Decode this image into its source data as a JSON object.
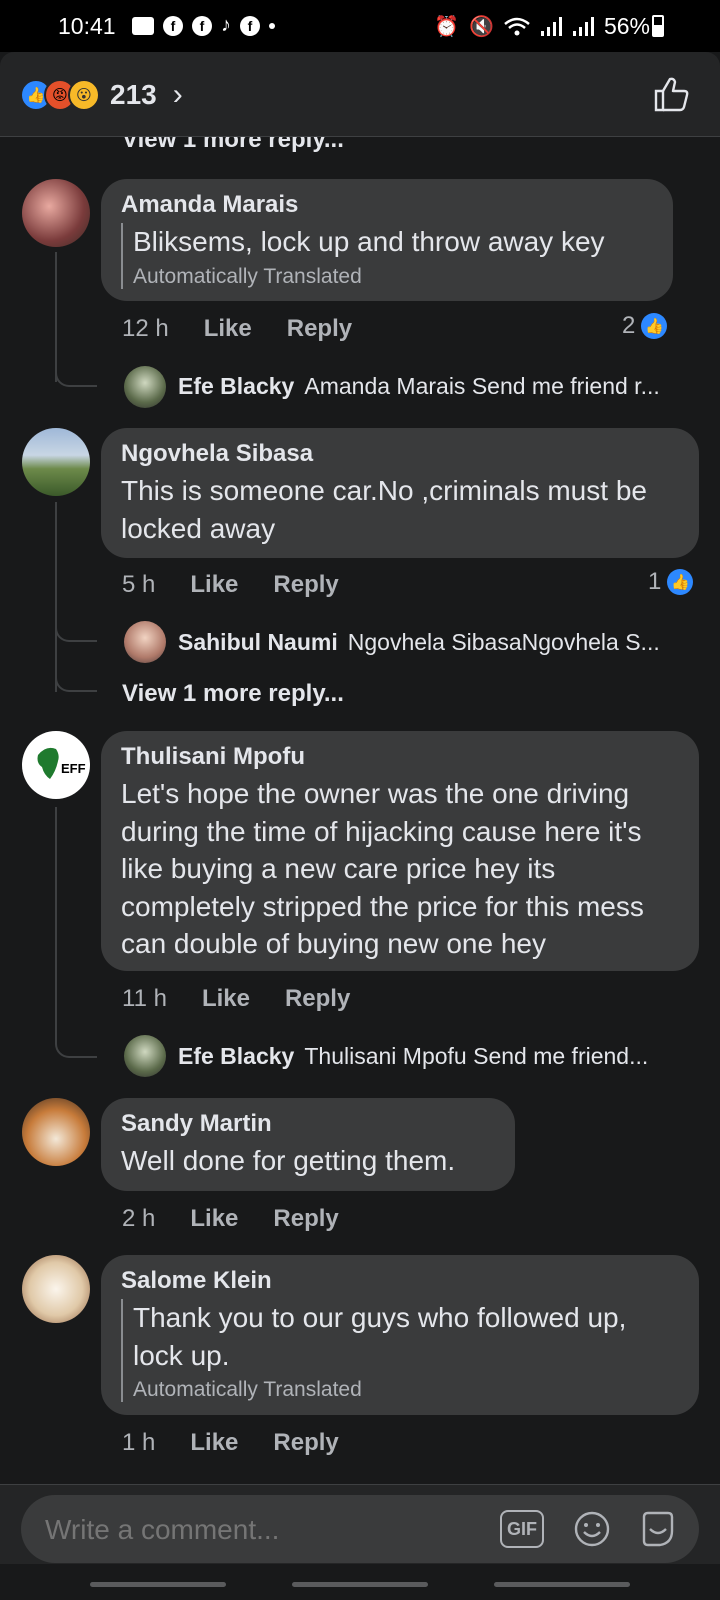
{
  "status_bar": {
    "time": "10:41",
    "battery": "56%"
  },
  "header": {
    "reaction_count": "213",
    "chevron": "›"
  },
  "thread": {
    "top_view_more": "View 1 more reply...",
    "comments": [
      {
        "author": "Amanda Marais",
        "text": "Bliksems, lock up and throw away key",
        "translated_label": "Automatically Translated",
        "time": "12 h",
        "like": "Like",
        "reply": "Reply",
        "likes": "2",
        "reply_preview": {
          "name": "Efe Blacky",
          "text": "Amanda Marais Send me friend r..."
        }
      },
      {
        "author": "Ngovhela Sibasa",
        "text": "This is someone  car.No ,criminals  must be locked  away",
        "time": "5 h",
        "like": "Like",
        "reply": "Reply",
        "likes": "1",
        "reply_preview": {
          "name": "Sahibul Naumi",
          "text": "Ngovhela SibasaNgovhela S..."
        },
        "view_more": "View 1 more reply..."
      },
      {
        "author": "Thulisani Mpofu",
        "text": "Let's hope the owner was the one driving during the time of hijacking cause here it's like buying a new care price hey its completely stripped the price for this mess can double of buying new one hey",
        "time": "11 h",
        "like": "Like",
        "reply": "Reply",
        "reply_preview": {
          "name": "Efe Blacky",
          "text": "Thulisani Mpofu Send me friend..."
        }
      },
      {
        "author": "Sandy Martin",
        "text": "Well done for getting them.",
        "time": "2 h",
        "like": "Like",
        "reply": "Reply"
      },
      {
        "author": "Salome Klein",
        "text": "Thank you to our guys who followed up, lock up.",
        "translated_label": "Automatically Translated",
        "time": "1 h",
        "like": "Like",
        "reply": "Reply"
      }
    ]
  },
  "composer": {
    "placeholder": "Write a comment...",
    "gif_label": "GIF"
  },
  "colors": {
    "background": "#18191a",
    "bubble": "#3a3b3c",
    "accent": "#2d88ff"
  }
}
